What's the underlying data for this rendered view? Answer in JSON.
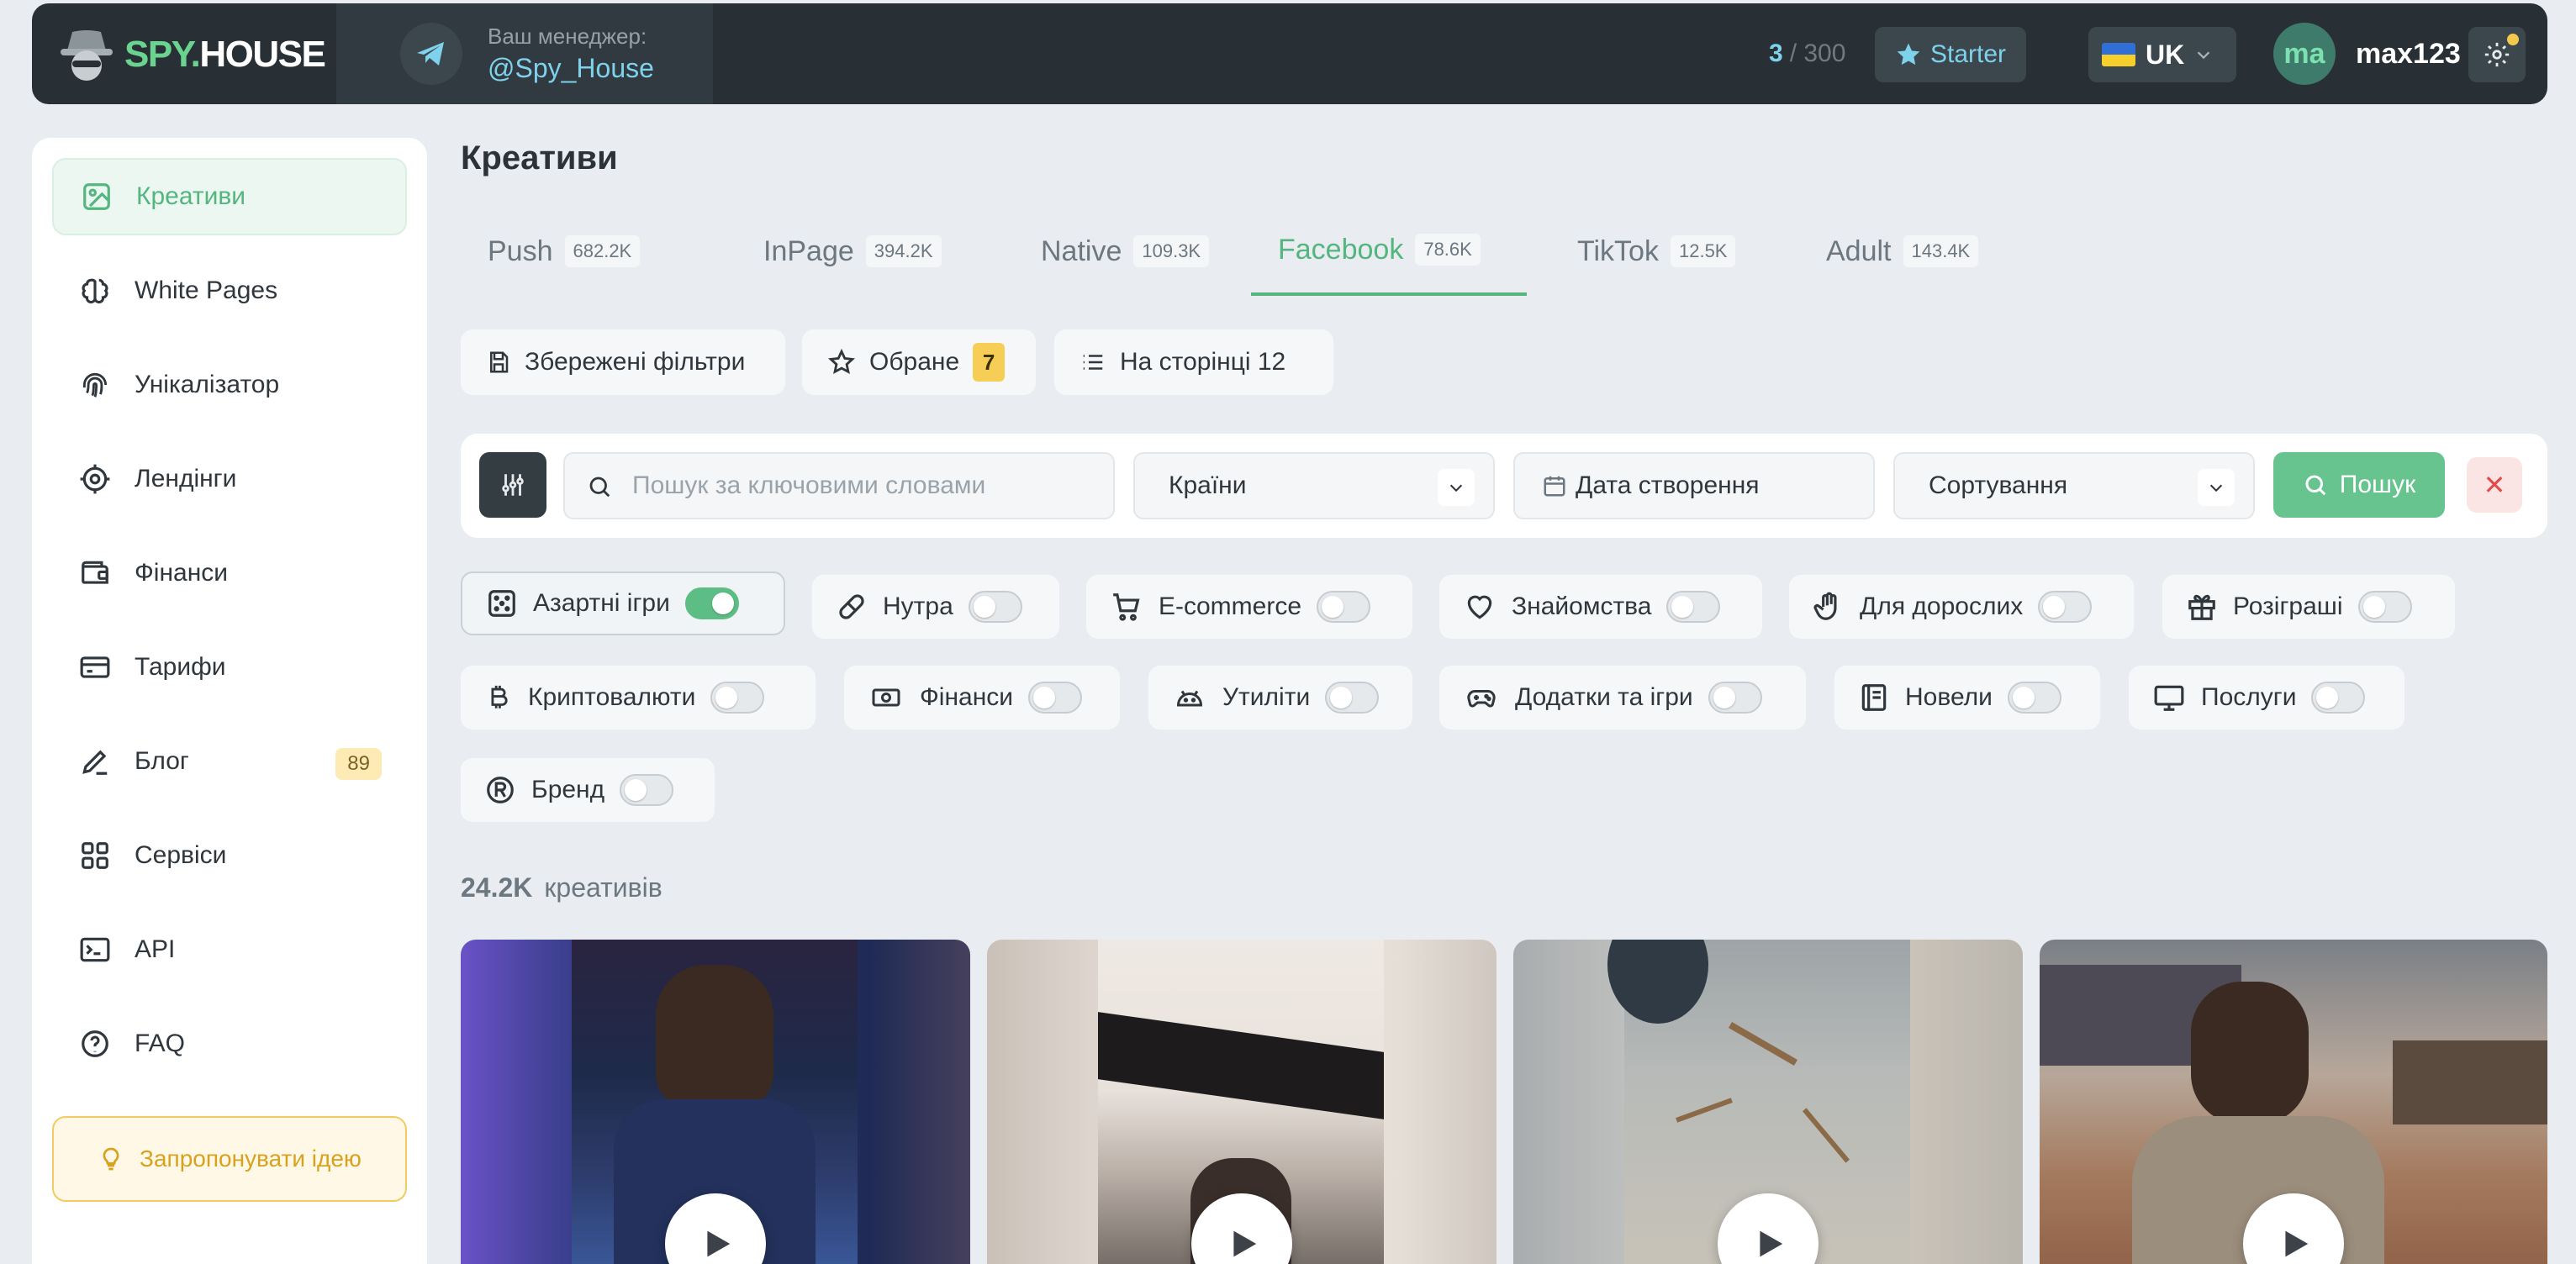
{
  "header": {
    "logo_text_spy": "SPY.",
    "logo_text_house": "HOUSE",
    "manager_label": "Ваш менеджер:",
    "manager_handle": "@Spy_House",
    "usage_current": "3",
    "usage_limit": "/ 300",
    "plan_label": "Starter",
    "language": "UK",
    "avatar_initials": "ma",
    "username": "max123"
  },
  "sidebar": {
    "items": [
      {
        "label": "Креативи",
        "icon": "image-icon",
        "active": true
      },
      {
        "label": "White Pages",
        "icon": "brain-icon"
      },
      {
        "label": "Унікалізатор",
        "icon": "fingerprint-icon"
      },
      {
        "label": "Лендінги",
        "icon": "target-icon"
      },
      {
        "label": "Фінанси",
        "icon": "wallet-icon"
      },
      {
        "label": "Тарифи",
        "icon": "card-icon"
      },
      {
        "label": "Блог",
        "icon": "pen-icon",
        "badge": "89"
      },
      {
        "label": "Сервіси",
        "icon": "grid-icon"
      },
      {
        "label": "API",
        "icon": "api-icon"
      },
      {
        "label": "FAQ",
        "icon": "help-icon"
      }
    ],
    "suggest_idea": "Запропонувати ідею"
  },
  "main": {
    "title": "Креативи",
    "tabs": [
      {
        "label": "Push",
        "count": "682.2K"
      },
      {
        "label": "InPage",
        "count": "394.2K"
      },
      {
        "label": "Native",
        "count": "109.3K"
      },
      {
        "label": "Facebook",
        "count": "78.6K",
        "active": true
      },
      {
        "label": "TikTok",
        "count": "12.5K"
      },
      {
        "label": "Adult",
        "count": "143.4K"
      }
    ],
    "quick": {
      "saved_filters": "Збережені фільтри",
      "favorites": "Обране",
      "favorites_count": "7",
      "per_page": "На сторінці 12"
    },
    "search": {
      "placeholder": "Пошук за ключовими словами",
      "countries": "Країни",
      "date": "Дата створення",
      "sort": "Сортування",
      "submit": "Пошук"
    },
    "categories": [
      {
        "label": "Азартні ігри",
        "icon": "dice-icon",
        "on": true
      },
      {
        "label": "Нутра",
        "icon": "pill-icon",
        "on": false
      },
      {
        "label": "E-commerce",
        "icon": "cart-icon",
        "on": false
      },
      {
        "label": "Знайомства",
        "icon": "heart-icon",
        "on": false
      },
      {
        "label": "Для дорослих",
        "icon": "hand-icon",
        "on": false
      },
      {
        "label": "Розіграші",
        "icon": "gift-icon",
        "on": false
      },
      {
        "label": "Криптовалюти",
        "icon": "bitcoin-icon",
        "on": false
      },
      {
        "label": "Фінанси",
        "icon": "banknote-icon",
        "on": false
      },
      {
        "label": "Утиліти",
        "icon": "android-icon",
        "on": false
      },
      {
        "label": "Додатки та ігри",
        "icon": "gamepad-icon",
        "on": false
      },
      {
        "label": "Новели",
        "icon": "book-icon",
        "on": false
      },
      {
        "label": "Послуги",
        "icon": "monitor-icon",
        "on": false
      },
      {
        "label": "Бренд",
        "icon": "registered-icon",
        "on": false
      }
    ],
    "results_count": "24.2K",
    "results_label": "креативів"
  },
  "colors": {
    "accent": "#54b57f",
    "topbar": "#283035",
    "link": "#7fd2ec"
  }
}
